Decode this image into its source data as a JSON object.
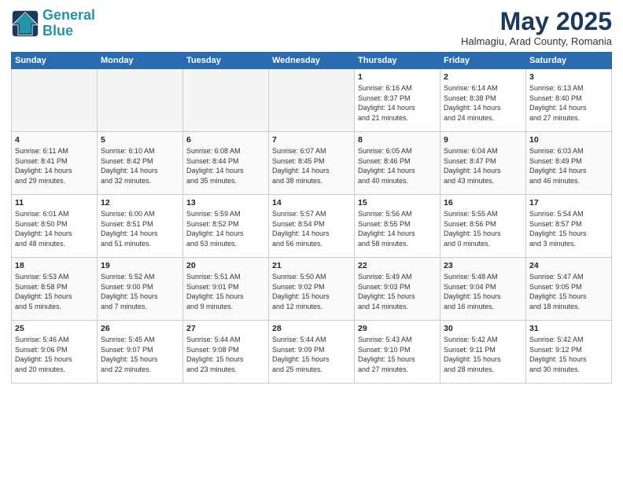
{
  "logo": {
    "line1": "General",
    "line2": "Blue"
  },
  "title": "May 2025",
  "subtitle": "Halmagiu, Arad County, Romania",
  "weekdays": [
    "Sunday",
    "Monday",
    "Tuesday",
    "Wednesday",
    "Thursday",
    "Friday",
    "Saturday"
  ],
  "weeks": [
    [
      {
        "day": "",
        "info": "",
        "empty": true
      },
      {
        "day": "",
        "info": "",
        "empty": true
      },
      {
        "day": "",
        "info": "",
        "empty": true
      },
      {
        "day": "",
        "info": "",
        "empty": true
      },
      {
        "day": "1",
        "info": "Sunrise: 6:16 AM\nSunset: 8:37 PM\nDaylight: 14 hours\nand 21 minutes."
      },
      {
        "day": "2",
        "info": "Sunrise: 6:14 AM\nSunset: 8:38 PM\nDaylight: 14 hours\nand 24 minutes."
      },
      {
        "day": "3",
        "info": "Sunrise: 6:13 AM\nSunset: 8:40 PM\nDaylight: 14 hours\nand 27 minutes."
      }
    ],
    [
      {
        "day": "4",
        "info": "Sunrise: 6:11 AM\nSunset: 8:41 PM\nDaylight: 14 hours\nand 29 minutes."
      },
      {
        "day": "5",
        "info": "Sunrise: 6:10 AM\nSunset: 8:42 PM\nDaylight: 14 hours\nand 32 minutes."
      },
      {
        "day": "6",
        "info": "Sunrise: 6:08 AM\nSunset: 8:44 PM\nDaylight: 14 hours\nand 35 minutes."
      },
      {
        "day": "7",
        "info": "Sunrise: 6:07 AM\nSunset: 8:45 PM\nDaylight: 14 hours\nand 38 minutes."
      },
      {
        "day": "8",
        "info": "Sunrise: 6:05 AM\nSunset: 8:46 PM\nDaylight: 14 hours\nand 40 minutes."
      },
      {
        "day": "9",
        "info": "Sunrise: 6:04 AM\nSunset: 8:47 PM\nDaylight: 14 hours\nand 43 minutes."
      },
      {
        "day": "10",
        "info": "Sunrise: 6:03 AM\nSunset: 8:49 PM\nDaylight: 14 hours\nand 46 minutes."
      }
    ],
    [
      {
        "day": "11",
        "info": "Sunrise: 6:01 AM\nSunset: 8:50 PM\nDaylight: 14 hours\nand 48 minutes."
      },
      {
        "day": "12",
        "info": "Sunrise: 6:00 AM\nSunset: 8:51 PM\nDaylight: 14 hours\nand 51 minutes."
      },
      {
        "day": "13",
        "info": "Sunrise: 5:59 AM\nSunset: 8:52 PM\nDaylight: 14 hours\nand 53 minutes."
      },
      {
        "day": "14",
        "info": "Sunrise: 5:57 AM\nSunset: 8:54 PM\nDaylight: 14 hours\nand 56 minutes."
      },
      {
        "day": "15",
        "info": "Sunrise: 5:56 AM\nSunset: 8:55 PM\nDaylight: 14 hours\nand 58 minutes."
      },
      {
        "day": "16",
        "info": "Sunrise: 5:55 AM\nSunset: 8:56 PM\nDaylight: 15 hours\nand 0 minutes."
      },
      {
        "day": "17",
        "info": "Sunrise: 5:54 AM\nSunset: 8:57 PM\nDaylight: 15 hours\nand 3 minutes."
      }
    ],
    [
      {
        "day": "18",
        "info": "Sunrise: 5:53 AM\nSunset: 8:58 PM\nDaylight: 15 hours\nand 5 minutes."
      },
      {
        "day": "19",
        "info": "Sunrise: 5:52 AM\nSunset: 9:00 PM\nDaylight: 15 hours\nand 7 minutes."
      },
      {
        "day": "20",
        "info": "Sunrise: 5:51 AM\nSunset: 9:01 PM\nDaylight: 15 hours\nand 9 minutes."
      },
      {
        "day": "21",
        "info": "Sunrise: 5:50 AM\nSunset: 9:02 PM\nDaylight: 15 hours\nand 12 minutes."
      },
      {
        "day": "22",
        "info": "Sunrise: 5:49 AM\nSunset: 9:03 PM\nDaylight: 15 hours\nand 14 minutes."
      },
      {
        "day": "23",
        "info": "Sunrise: 5:48 AM\nSunset: 9:04 PM\nDaylight: 15 hours\nand 16 minutes."
      },
      {
        "day": "24",
        "info": "Sunrise: 5:47 AM\nSunset: 9:05 PM\nDaylight: 15 hours\nand 18 minutes."
      }
    ],
    [
      {
        "day": "25",
        "info": "Sunrise: 5:46 AM\nSunset: 9:06 PM\nDaylight: 15 hours\nand 20 minutes."
      },
      {
        "day": "26",
        "info": "Sunrise: 5:45 AM\nSunset: 9:07 PM\nDaylight: 15 hours\nand 22 minutes."
      },
      {
        "day": "27",
        "info": "Sunrise: 5:44 AM\nSunset: 9:08 PM\nDaylight: 15 hours\nand 23 minutes."
      },
      {
        "day": "28",
        "info": "Sunrise: 5:44 AM\nSunset: 9:09 PM\nDaylight: 15 hours\nand 25 minutes."
      },
      {
        "day": "29",
        "info": "Sunrise: 5:43 AM\nSunset: 9:10 PM\nDaylight: 15 hours\nand 27 minutes."
      },
      {
        "day": "30",
        "info": "Sunrise: 5:42 AM\nSunset: 9:11 PM\nDaylight: 15 hours\nand 28 minutes."
      },
      {
        "day": "31",
        "info": "Sunrise: 5:42 AM\nSunset: 9:12 PM\nDaylight: 15 hours\nand 30 minutes."
      }
    ]
  ]
}
